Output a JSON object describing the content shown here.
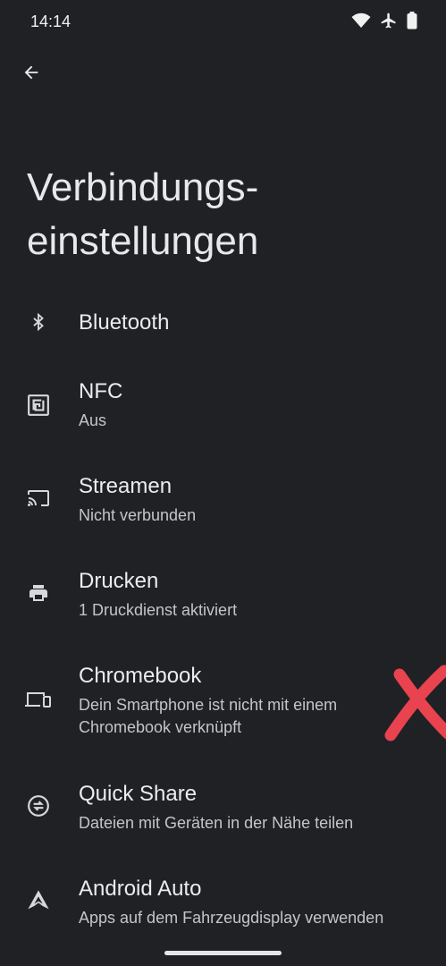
{
  "status_bar": {
    "time": "14:14",
    "icons": [
      "wifi-icon",
      "airplane-icon",
      "battery-icon"
    ]
  },
  "header": {
    "back_icon": "arrow-left-icon",
    "title_line1": "Verbindungs-",
    "title_line2": "einstellungen"
  },
  "items": [
    {
      "label": "Bluetooth",
      "summary": "",
      "icon": "bluetooth-icon"
    },
    {
      "label": "NFC",
      "summary": "Aus",
      "icon": "nfc-icon"
    },
    {
      "label": "Streamen",
      "summary": "Nicht verbunden",
      "icon": "cast-icon"
    },
    {
      "label": "Drucken",
      "summary": "1 Druckdienst aktiviert",
      "icon": "printer-icon"
    },
    {
      "label": "Chromebook",
      "summary_line1": "Dein Smartphone ist nicht mit einem",
      "summary_line2": "Chromebook verknüpft",
      "icon": "devices-icon"
    },
    {
      "label": "Quick Share",
      "summary": "Dateien mit Geräten in der Nähe teilen",
      "icon": "quick-share-icon"
    },
    {
      "label": "Android Auto",
      "summary": "Apps auf dem Fahrzeugdisplay verwenden",
      "icon": "android-auto-icon"
    }
  ],
  "colors": {
    "background": "#1f2125",
    "text_primary": "#ececee",
    "text_secondary": "#c4c5c9",
    "annotation_mark": "#e8434f"
  }
}
